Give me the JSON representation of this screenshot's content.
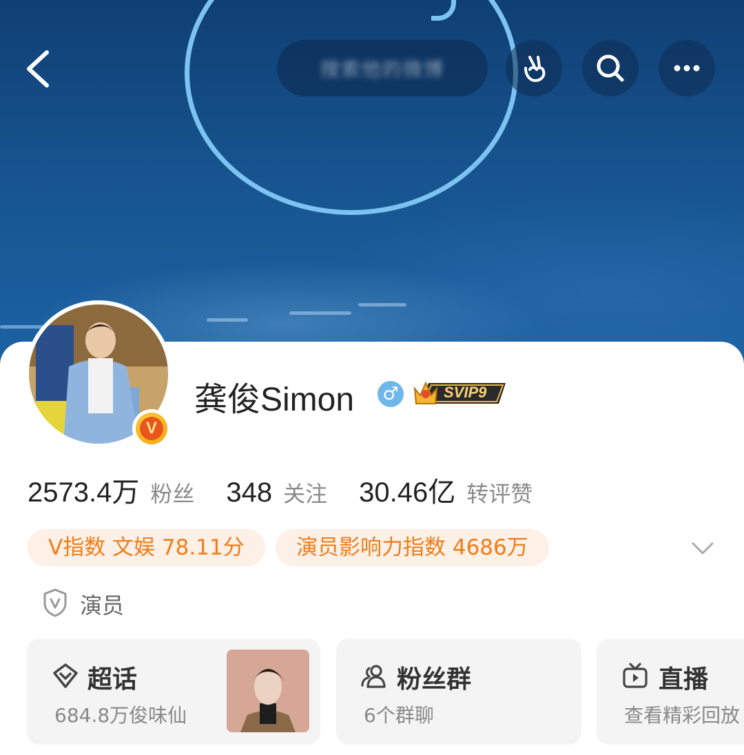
{
  "header": {
    "search_placeholder": "搜索他的微博",
    "back_icon": "back-arrow-icon",
    "actions": [
      "nudge-hand-icon",
      "search-icon",
      "more-icon"
    ]
  },
  "profile": {
    "name": "龚俊Simon",
    "gender_symbol": "♂",
    "svip_label": "SVIP9",
    "verified_letter": "V"
  },
  "stats": [
    {
      "value": "2573.4万",
      "label": "粉丝"
    },
    {
      "value": "348",
      "label": "关注"
    },
    {
      "value": "30.46亿",
      "label": "转评赞"
    }
  ],
  "tags": [
    {
      "label": "V指数 文娱 78.11分"
    },
    {
      "label": "演员影响力指数 4686万"
    }
  ],
  "certification": {
    "label": "演员",
    "icon": "verified-shield-icon"
  },
  "tiles": [
    {
      "title": "超话",
      "subtitle": "684.8万俊味仙",
      "icon": "supertopic-diamond-icon"
    },
    {
      "title": "粉丝群",
      "subtitle": "6个群聊",
      "icon": "fan-group-icon"
    },
    {
      "title": "直播",
      "subtitle": "查看精彩回放",
      "icon": "tv-icon"
    }
  ],
  "colors": {
    "accent_orange": "#ef7d1a",
    "tag_bg": "#fdf0e6",
    "banner_blue": "#17548f",
    "annotation_circle": "#7cc3f1"
  }
}
